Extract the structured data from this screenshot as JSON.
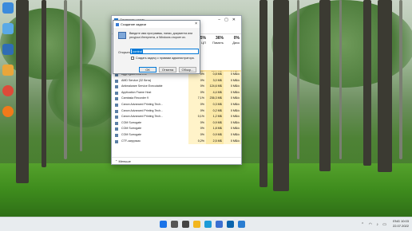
{
  "taskmanager": {
    "title": "Диспетчер задач",
    "menu": [
      "Файл",
      "Параметры",
      "Вид"
    ],
    "columns": {
      "cpu": {
        "pct": "5%",
        "label": "ЦП"
      },
      "memory": {
        "pct": "36%",
        "label": "Память"
      },
      "disk": {
        "pct": "0%",
        "label": "Диск"
      }
    },
    "highlight_row": {
      "cpu": "0%",
      "memory": "67,1 МБ",
      "disk": "0 МБ/с"
    },
    "rows": [
      {
        "name": "AggregatorHost.exe",
        "cpu": "0%",
        "mem": "0,8 МБ",
        "disk": "0 МБ/с"
      },
      {
        "name": "AMD Service (32 бита)",
        "cpu": "0%",
        "mem": "3,0 МБ",
        "disk": "0 МБ/с"
      },
      {
        "name": "Antimalware Service Executable",
        "cpu": "0%",
        "mem": "124,6 МБ",
        "disk": "0 МБ/с"
      },
      {
        "name": "Application Frame Host",
        "cpu": "0%",
        "mem": "4,4 МБ",
        "disk": "0 МБ/с"
      },
      {
        "name": "Camtasia Recorder 9",
        "cpu": "7,1%",
        "mem": "236,3 МБ",
        "disk": "0 МБ/с"
      },
      {
        "name": "Canon Advanced Printing Tech...",
        "cpu": "0%",
        "mem": "0,3 МБ",
        "disk": "0 МБ/с"
      },
      {
        "name": "Canon Advanced Printing Tech...",
        "cpu": "0%",
        "mem": "0,2 МБ",
        "disk": "0 МБ/с"
      },
      {
        "name": "Canon Advanced Printing Tech...",
        "cpu": "0,1%",
        "mem": "1,2 МБ",
        "disk": "0 МБ/с"
      },
      {
        "name": "COM Surrogate",
        "cpu": "0%",
        "mem": "0,9 МБ",
        "disk": "0 МБ/с"
      },
      {
        "name": "COM Surrogate",
        "cpu": "0%",
        "mem": "1,8 МБ",
        "disk": "0 МБ/с"
      },
      {
        "name": "COM Surrogate",
        "cpu": "0%",
        "mem": "0,9 МБ",
        "disk": "0 МБ/с"
      },
      {
        "name": "CTF-загрузчик",
        "cpu": "0,2%",
        "mem": "2,5 МБ",
        "disk": "0 МБ/с"
      }
    ],
    "footer": "Меньше"
  },
  "run_dialog": {
    "title": "Создание задачи",
    "close": "×",
    "description": "Введите имя программы, папки, документа или ресурса Интернета, и Windows откроет их.",
    "open_label": "Открыть:",
    "input_value": "control",
    "checkbox_label": "Создать задачу с правами администратора.",
    "ok": "ОК",
    "cancel": "Отмена",
    "browse": "Обзор..."
  },
  "tray": {
    "lang": "ENG",
    "time": "10:03",
    "date": "22.07.2022",
    "icons": "⌃ ◠ ♪ ▭"
  },
  "taskbar_icons": [
    "start-icon",
    "search-icon",
    "taskview-icon",
    "explorer-icon",
    "edge-icon",
    "store-icon",
    "mail-icon",
    "taskmgr-icon"
  ],
  "desktop_icon_colors": [
    "#3c8bdc",
    "#5aa9e6",
    "#2f6db5",
    "#e9a63b",
    "#dd4b39",
    "#f07a1a"
  ]
}
